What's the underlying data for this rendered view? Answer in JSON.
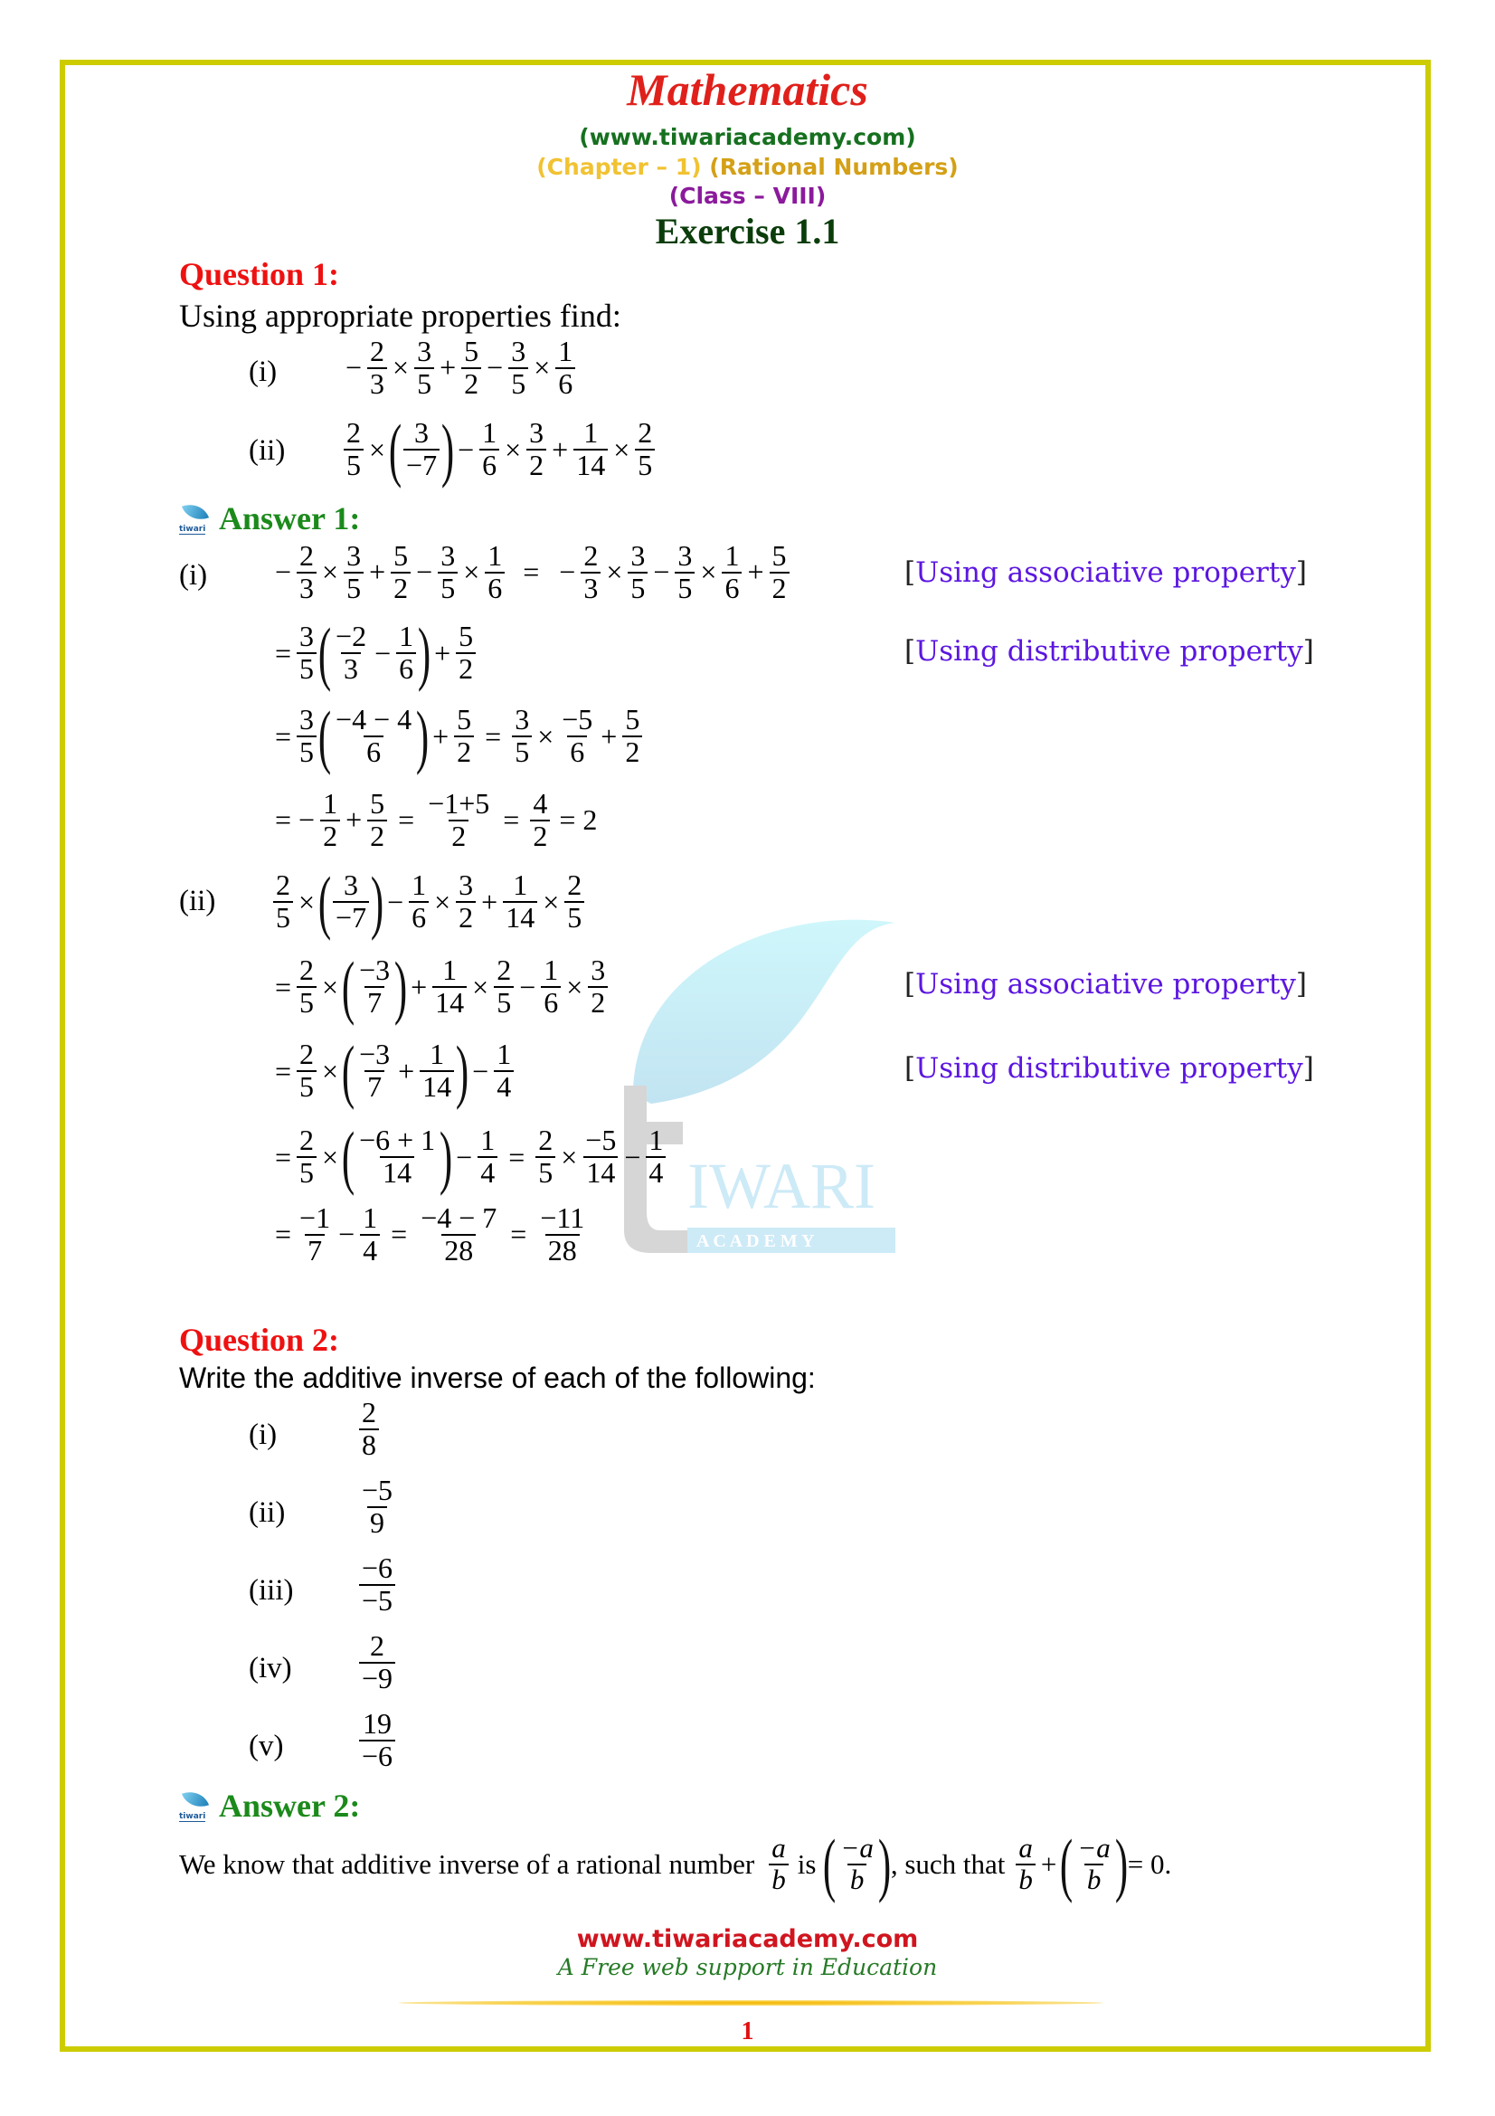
{
  "header": {
    "title": "Mathematics",
    "website": "(www.tiwariacademy.com)",
    "chapter": "(Chapter – 1)",
    "chapter_name": "(Rational Numbers)",
    "class": "(Class – VIII)",
    "exercise": "Exercise 1.1"
  },
  "question1": {
    "heading": "Question 1:",
    "prompt": "Using appropriate properties find:",
    "parts": [
      {
        "label": "(i)"
      },
      {
        "label": "(ii)"
      }
    ]
  },
  "answer1": {
    "heading": "Answer 1:",
    "icon_label": "tiwari",
    "part_i_label": "(i)",
    "part_ii_label": "(ii)",
    "notes": {
      "bracket_open": "[",
      "bracket_close": "]",
      "associative": "Using associative property",
      "distributive": "Using distributive property"
    }
  },
  "question2": {
    "heading": "Question 2:",
    "prompt": "Write the additive inverse of each of the following:",
    "items": [
      {
        "label": "(i)",
        "num": "2",
        "den": "8"
      },
      {
        "label": "(ii)",
        "num": "−5",
        "den": "9"
      },
      {
        "label": "(iii)",
        "num": "−6",
        "den": "−5"
      },
      {
        "label": "(iv)",
        "num": "2",
        "den": "−9"
      },
      {
        "label": "(v)",
        "num": "19",
        "den": "−6"
      }
    ]
  },
  "answer2": {
    "heading": "Answer 2:",
    "text_before": "We know that additive inverse of a rational number",
    "is": "is",
    "such_that": ", such that",
    "equals_zero": "= 0."
  },
  "watermark": {
    "brand": "IWARI",
    "sub": "A C A D E M Y"
  },
  "footer": {
    "website": "www.tiwariacademy.com",
    "tagline": "A Free web support in Education",
    "page_number": "1"
  },
  "colors": {
    "frame": "#cccc00",
    "title": "#e0201b",
    "question": "#ee1111",
    "answer": "#1b8a1b",
    "note": "#5b16e0"
  }
}
